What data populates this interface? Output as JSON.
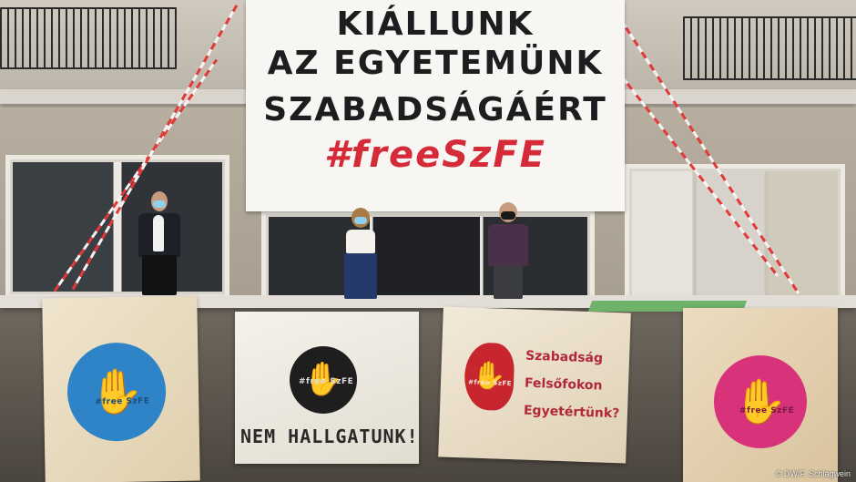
{
  "main_banner": {
    "line1": "KIÁLLUNK",
    "line2": "AZ EGYETEMÜNK",
    "line3": "SZABADSÁGÁÉRT",
    "line4": "#freeSzFE"
  },
  "lower_banners": {
    "banner1_logo": "#free SzFE",
    "banner2_logo": "#free SzFE",
    "banner2_text": "NEM HALLGATUNK!",
    "banner3_logo": "#free SzFE",
    "banner3_lines": [
      "Szabadság",
      "Felsőfokon",
      "Egyetértünk?"
    ],
    "banner4_logo": "#free SzFE"
  },
  "credit": "© DW/F. Schlagwein",
  "colors": {
    "accent_red": "#d52a38",
    "blue_circle": "#2f84c8",
    "black_circle": "#1e1e1e",
    "red_circle": "#c8262f",
    "pink_circle": "#d8327b"
  }
}
